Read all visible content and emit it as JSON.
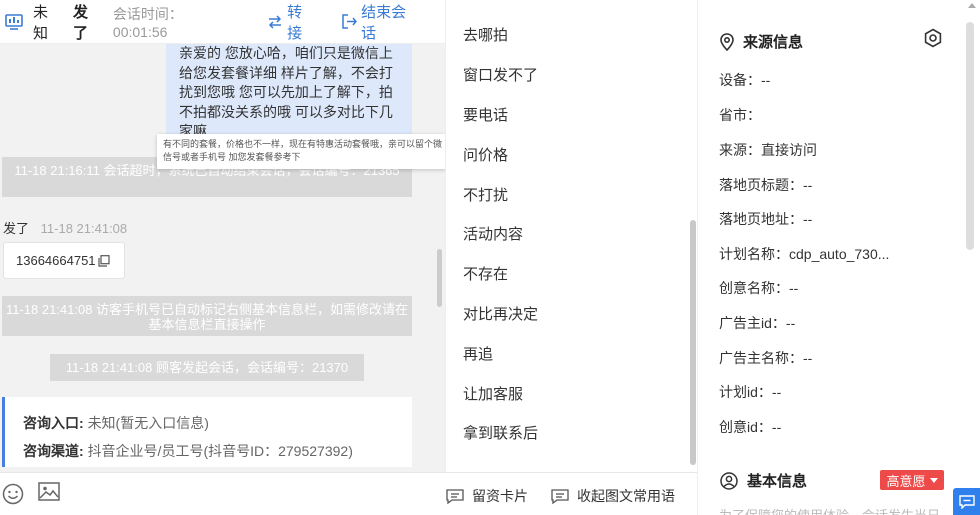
{
  "chat": {
    "header": {
      "visitor_name": "未知",
      "visitor_name2": "发了",
      "session_time": "会话时间：00:01:56",
      "transfer_label": "转接",
      "end_label": "结束会话"
    },
    "bubble_text": "亲爱的 您放心哈，咱们只是微信上给您发套餐详细 样片了解，不会打扰到您哦 您可以先加上了解下，拍不拍都没关系的哦 可以多对比下几家嘛",
    "tooltip_text": "有不同的套餐，价格也不一样，现在有特惠活动套餐哦，亲可以留个微信号或者手机号 加您发套餐参考下",
    "system_msg_1": "11-18 21:16:11 会话超时，系统已自动结束会话，会话编号：21365",
    "sender_name": "发了",
    "sender_time": "11-18 21:41:08",
    "phone_number": "13664664751",
    "system_msg_2": "11-18 21:41:08 访客手机号已自动标记右侧基本信息栏，如需修改请在基本信息栏直接操作",
    "system_msg_3": "11-18 21:41:08 顾客发起会话，会话编号：21370",
    "info_card": {
      "entry_key": "咨询入口:",
      "entry_value": "未知(暂无入口信息)",
      "channel_key": "咨询渠道:",
      "channel_value": "抖音企业号/员工号(抖音号ID：279527392)"
    },
    "footer": {
      "emoji_icon": "emoji-icon",
      "image_icon": "image-icon"
    }
  },
  "phrases": {
    "top_cut": "去哪拍(部分)",
    "items": [
      "去哪拍",
      "窗口发不了",
      "要电话",
      "问价格",
      "不打扰",
      "活动内容",
      "不存在",
      "对比再决定",
      "再追",
      "让加客服",
      "拿到联系后"
    ],
    "footer": {
      "card_label": "留资卡片",
      "collapse_label": "收起图文常用语"
    }
  },
  "right": {
    "source_title": "来源信息",
    "fields": [
      {
        "label": "设备：",
        "value": "--"
      },
      {
        "label": "省市：",
        "value": ""
      },
      {
        "label": "来源：",
        "value": "直接访问"
      },
      {
        "label": "落地页标题：",
        "value": "--"
      },
      {
        "label": "落地页地址：",
        "value": "--"
      },
      {
        "label": "计划名称：",
        "value": "cdp_auto_730..."
      },
      {
        "label": "创意名称：",
        "value": "--"
      },
      {
        "label": "广告主id：",
        "value": "--"
      },
      {
        "label": "广告主名称：",
        "value": "--"
      },
      {
        "label": "计划id：",
        "value": "--"
      },
      {
        "label": "创意id：",
        "value": "--"
      }
    ],
    "basic_title": "基本信息",
    "intent_badge": "高意愿",
    "cutoff_text": "为了保障您的使用体验，会话发生当日"
  },
  "colors": {
    "accent": "#3a7bd5",
    "bubble": "#dde8fb",
    "system": "#d9d9d9",
    "badge": "#ee4a4a"
  }
}
